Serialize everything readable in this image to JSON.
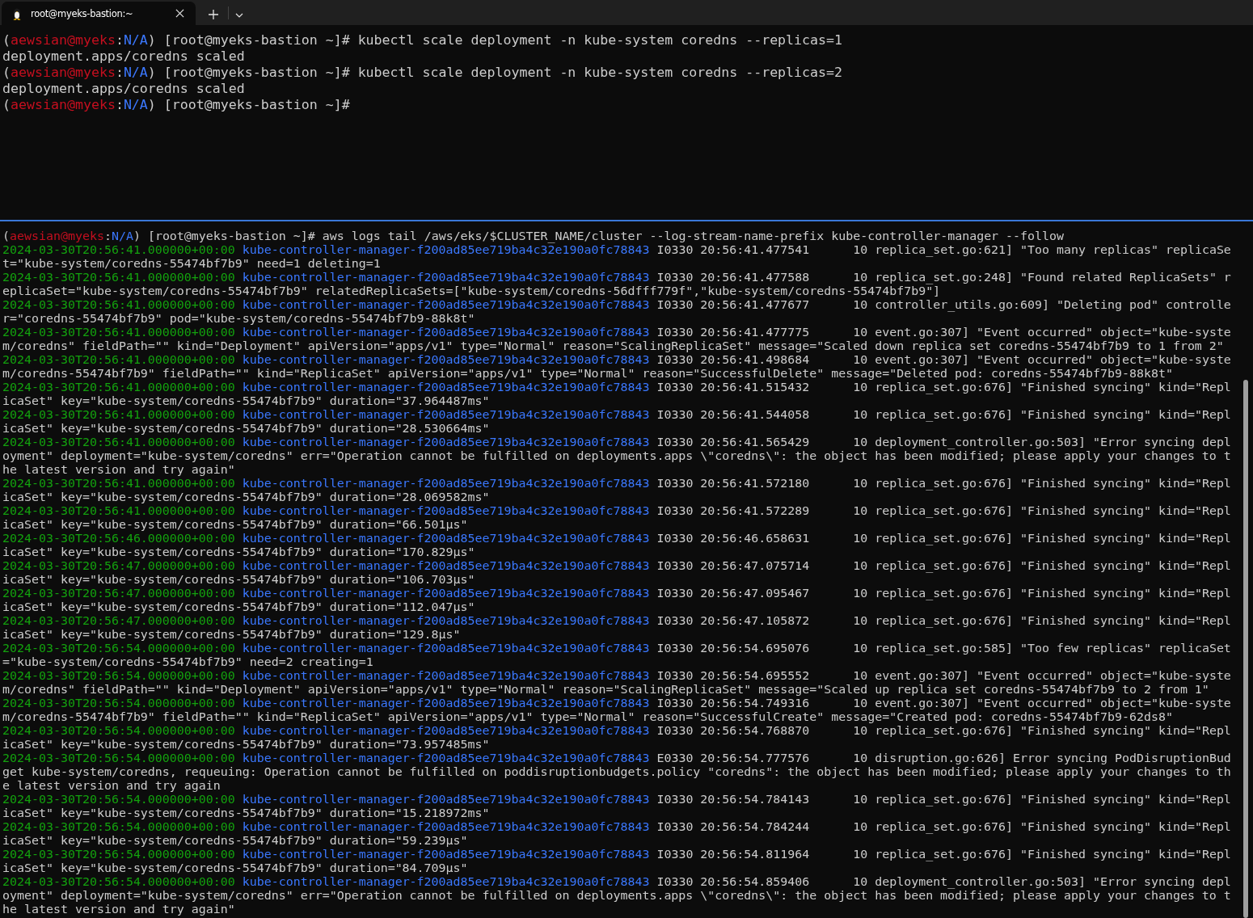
{
  "tab": {
    "title": "root@myeks-bastion:~",
    "selected": true
  },
  "top_pane": {
    "lines": [
      {
        "kind": "prompt",
        "prompt": [
          {
            "kind": "plain",
            "text": "("
          },
          {
            "kind": "user",
            "text": "aewsian@myeks"
          },
          {
            "kind": "plain",
            "text": ":"
          },
          {
            "kind": "context",
            "text": "N/A"
          },
          {
            "kind": "plain",
            "text": ") [root@myeks-bastion ~]#"
          }
        ],
        "command": "kubectl scale deployment -n kube-system coredns --replicas=1"
      },
      {
        "kind": "output",
        "text": "deployment.apps/coredns scaled"
      },
      {
        "kind": "prompt",
        "prompt": [
          {
            "kind": "plain",
            "text": "("
          },
          {
            "kind": "user",
            "text": "aewsian@myeks"
          },
          {
            "kind": "plain",
            "text": ":"
          },
          {
            "kind": "context",
            "text": "N/A"
          },
          {
            "kind": "plain",
            "text": ") [root@myeks-bastion ~]#"
          }
        ],
        "command": "kubectl scale deployment -n kube-system coredns --replicas=2"
      },
      {
        "kind": "output",
        "text": "deployment.apps/coredns scaled"
      },
      {
        "kind": "prompt",
        "prompt": [
          {
            "kind": "plain",
            "text": "("
          },
          {
            "kind": "user",
            "text": "aewsian@myeks"
          },
          {
            "kind": "plain",
            "text": ":"
          },
          {
            "kind": "context",
            "text": "N/A"
          },
          {
            "kind": "plain",
            "text": ") [root@myeks-bastion ~]#"
          }
        ]
      }
    ]
  },
  "bottom_pane": {
    "lines": [
      {
        "kind": "prompt",
        "prompt": [
          {
            "kind": "plain",
            "text": "("
          },
          {
            "kind": "user",
            "text": "aewsian@myeks"
          },
          {
            "kind": "plain",
            "text": ":"
          },
          {
            "kind": "context",
            "text": "N/A"
          },
          {
            "kind": "plain",
            "text": ") [root@myeks-bastion ~]#"
          }
        ],
        "command": "aws logs tail /aws/eks/$CLUSTER_NAME/cluster --log-stream-name-prefix kube-controller-manager --follow"
      },
      {
        "kind": "log",
        "timestamp": "2024-03-30T20:56:41.000000+00:00",
        "stream": "kube-controller-manager-f200ad85ee719ba4c32e190a0fc78843",
        "message": "I0330 20:56:41.477541      10 replica_set.go:621] \"Too many replicas\" replicaSet=\"kube-system/coredns-55474bf7b9\" need=1 deleting=1"
      },
      {
        "kind": "log",
        "timestamp": "2024-03-30T20:56:41.000000+00:00",
        "stream": "kube-controller-manager-f200ad85ee719ba4c32e190a0fc78843",
        "message": "I0330 20:56:41.477588      10 replica_set.go:248] \"Found related ReplicaSets\" replicaSet=\"kube-system/coredns-55474bf7b9\" relatedReplicaSets=[\"kube-system/coredns-56dfff779f\",\"kube-system/coredns-55474bf7b9\"]"
      },
      {
        "kind": "log",
        "timestamp": "2024-03-30T20:56:41.000000+00:00",
        "stream": "kube-controller-manager-f200ad85ee719ba4c32e190a0fc78843",
        "message": "I0330 20:56:41.477677      10 controller_utils.go:609] \"Deleting pod\" controller=\"coredns-55474bf7b9\" pod=\"kube-system/coredns-55474bf7b9-88k8t\""
      },
      {
        "kind": "log",
        "timestamp": "2024-03-30T20:56:41.000000+00:00",
        "stream": "kube-controller-manager-f200ad85ee719ba4c32e190a0fc78843",
        "message": "I0330 20:56:41.477775      10 event.go:307] \"Event occurred\" object=\"kube-system/coredns\" fieldPath=\"\" kind=\"Deployment\" apiVersion=\"apps/v1\" type=\"Normal\" reason=\"ScalingReplicaSet\" message=\"Scaled down replica set coredns-55474bf7b9 to 1 from 2\""
      },
      {
        "kind": "log",
        "timestamp": "2024-03-30T20:56:41.000000+00:00",
        "stream": "kube-controller-manager-f200ad85ee719ba4c32e190a0fc78843",
        "message": "I0330 20:56:41.498684      10 event.go:307] \"Event occurred\" object=\"kube-system/coredns-55474bf7b9\" fieldPath=\"\" kind=\"ReplicaSet\" apiVersion=\"apps/v1\" type=\"Normal\" reason=\"SuccessfulDelete\" message=\"Deleted pod: coredns-55474bf7b9-88k8t\""
      },
      {
        "kind": "log",
        "timestamp": "2024-03-30T20:56:41.000000+00:00",
        "stream": "kube-controller-manager-f200ad85ee719ba4c32e190a0fc78843",
        "message": "I0330 20:56:41.515432      10 replica_set.go:676] \"Finished syncing\" kind=\"ReplicaSet\" key=\"kube-system/coredns-55474bf7b9\" duration=\"37.964487ms\""
      },
      {
        "kind": "log",
        "timestamp": "2024-03-30T20:56:41.000000+00:00",
        "stream": "kube-controller-manager-f200ad85ee719ba4c32e190a0fc78843",
        "message": "I0330 20:56:41.544058      10 replica_set.go:676] \"Finished syncing\" kind=\"ReplicaSet\" key=\"kube-system/coredns-55474bf7b9\" duration=\"28.530664ms\""
      },
      {
        "kind": "log",
        "timestamp": "2024-03-30T20:56:41.000000+00:00",
        "stream": "kube-controller-manager-f200ad85ee719ba4c32e190a0fc78843",
        "message": "I0330 20:56:41.565429      10 deployment_controller.go:503] \"Error syncing deployment\" deployment=\"kube-system/coredns\" err=\"Operation cannot be fulfilled on deployments.apps \\\"coredns\\\": the object has been modified; please apply your changes to the latest version and try again\""
      },
      {
        "kind": "log",
        "timestamp": "2024-03-30T20:56:41.000000+00:00",
        "stream": "kube-controller-manager-f200ad85ee719ba4c32e190a0fc78843",
        "message": "I0330 20:56:41.572180      10 replica_set.go:676] \"Finished syncing\" kind=\"ReplicaSet\" key=\"kube-system/coredns-55474bf7b9\" duration=\"28.069582ms\""
      },
      {
        "kind": "log",
        "timestamp": "2024-03-30T20:56:41.000000+00:00",
        "stream": "kube-controller-manager-f200ad85ee719ba4c32e190a0fc78843",
        "message": "I0330 20:56:41.572289      10 replica_set.go:676] \"Finished syncing\" kind=\"ReplicaSet\" key=\"kube-system/coredns-55474bf7b9\" duration=\"66.501µs\""
      },
      {
        "kind": "log",
        "timestamp": "2024-03-30T20:56:46.000000+00:00",
        "stream": "kube-controller-manager-f200ad85ee719ba4c32e190a0fc78843",
        "message": "I0330 20:56:46.658631      10 replica_set.go:676] \"Finished syncing\" kind=\"ReplicaSet\" key=\"kube-system/coredns-55474bf7b9\" duration=\"170.829µs\""
      },
      {
        "kind": "log",
        "timestamp": "2024-03-30T20:56:47.000000+00:00",
        "stream": "kube-controller-manager-f200ad85ee719ba4c32e190a0fc78843",
        "message": "I0330 20:56:47.075714      10 replica_set.go:676] \"Finished syncing\" kind=\"ReplicaSet\" key=\"kube-system/coredns-55474bf7b9\" duration=\"106.703µs\""
      },
      {
        "kind": "log",
        "timestamp": "2024-03-30T20:56:47.000000+00:00",
        "stream": "kube-controller-manager-f200ad85ee719ba4c32e190a0fc78843",
        "message": "I0330 20:56:47.095467      10 replica_set.go:676] \"Finished syncing\" kind=\"ReplicaSet\" key=\"kube-system/coredns-55474bf7b9\" duration=\"112.047µs\""
      },
      {
        "kind": "log",
        "timestamp": "2024-03-30T20:56:47.000000+00:00",
        "stream": "kube-controller-manager-f200ad85ee719ba4c32e190a0fc78843",
        "message": "I0330 20:56:47.105872      10 replica_set.go:676] \"Finished syncing\" kind=\"ReplicaSet\" key=\"kube-system/coredns-55474bf7b9\" duration=\"129.8µs\""
      },
      {
        "kind": "log",
        "timestamp": "2024-03-30T20:56:54.000000+00:00",
        "stream": "kube-controller-manager-f200ad85ee719ba4c32e190a0fc78843",
        "message": "I0330 20:56:54.695076      10 replica_set.go:585] \"Too few replicas\" replicaSet=\"kube-system/coredns-55474bf7b9\" need=2 creating=1"
      },
      {
        "kind": "log",
        "timestamp": "2024-03-30T20:56:54.000000+00:00",
        "stream": "kube-controller-manager-f200ad85ee719ba4c32e190a0fc78843",
        "message": "I0330 20:56:54.695552      10 event.go:307] \"Event occurred\" object=\"kube-system/coredns\" fieldPath=\"\" kind=\"Deployment\" apiVersion=\"apps/v1\" type=\"Normal\" reason=\"ScalingReplicaSet\" message=\"Scaled up replica set coredns-55474bf7b9 to 2 from 1\""
      },
      {
        "kind": "log",
        "timestamp": "2024-03-30T20:56:54.000000+00:00",
        "stream": "kube-controller-manager-f200ad85ee719ba4c32e190a0fc78843",
        "message": "I0330 20:56:54.749316      10 event.go:307] \"Event occurred\" object=\"kube-system/coredns-55474bf7b9\" fieldPath=\"\" kind=\"ReplicaSet\" apiVersion=\"apps/v1\" type=\"Normal\" reason=\"SuccessfulCreate\" message=\"Created pod: coredns-55474bf7b9-62ds8\""
      },
      {
        "kind": "log",
        "timestamp": "2024-03-30T20:56:54.000000+00:00",
        "stream": "kube-controller-manager-f200ad85ee719ba4c32e190a0fc78843",
        "message": "I0330 20:56:54.768870      10 replica_set.go:676] \"Finished syncing\" kind=\"ReplicaSet\" key=\"kube-system/coredns-55474bf7b9\" duration=\"73.957485ms\""
      },
      {
        "kind": "log",
        "timestamp": "2024-03-30T20:56:54.000000+00:00",
        "stream": "kube-controller-manager-f200ad85ee719ba4c32e190a0fc78843",
        "message": "E0330 20:56:54.777576      10 disruption.go:626] Error syncing PodDisruptionBudget kube-system/coredns, requeuing: Operation cannot be fulfilled on poddisruptionbudgets.policy \"coredns\": the object has been modified; please apply your changes to the latest version and try again"
      },
      {
        "kind": "log",
        "timestamp": "2024-03-30T20:56:54.000000+00:00",
        "stream": "kube-controller-manager-f200ad85ee719ba4c32e190a0fc78843",
        "message": "I0330 20:56:54.784143      10 replica_set.go:676] \"Finished syncing\" kind=\"ReplicaSet\" key=\"kube-system/coredns-55474bf7b9\" duration=\"15.218972ms\""
      },
      {
        "kind": "log",
        "timestamp": "2024-03-30T20:56:54.000000+00:00",
        "stream": "kube-controller-manager-f200ad85ee719ba4c32e190a0fc78843",
        "message": "I0330 20:56:54.784244      10 replica_set.go:676] \"Finished syncing\" kind=\"ReplicaSet\" key=\"kube-system/coredns-55474bf7b9\" duration=\"59.239µs\""
      },
      {
        "kind": "log",
        "timestamp": "2024-03-30T20:56:54.000000+00:00",
        "stream": "kube-controller-manager-f200ad85ee719ba4c32e190a0fc78843",
        "message": "I0330 20:56:54.811964      10 replica_set.go:676] \"Finished syncing\" kind=\"ReplicaSet\" key=\"kube-system/coredns-55474bf7b9\" duration=\"84.709µs\""
      },
      {
        "kind": "log",
        "timestamp": "2024-03-30T20:56:54.000000+00:00",
        "stream": "kube-controller-manager-f200ad85ee719ba4c32e190a0fc78843",
        "message": "I0330 20:56:54.859406      10 deployment_controller.go:503] \"Error syncing deployment\" deployment=\"kube-system/coredns\" err=\"Operation cannot be fulfilled on deployments.apps \\\"coredns\\\": the object has been modified; please apply your changes to the latest version and try again\""
      }
    ]
  }
}
